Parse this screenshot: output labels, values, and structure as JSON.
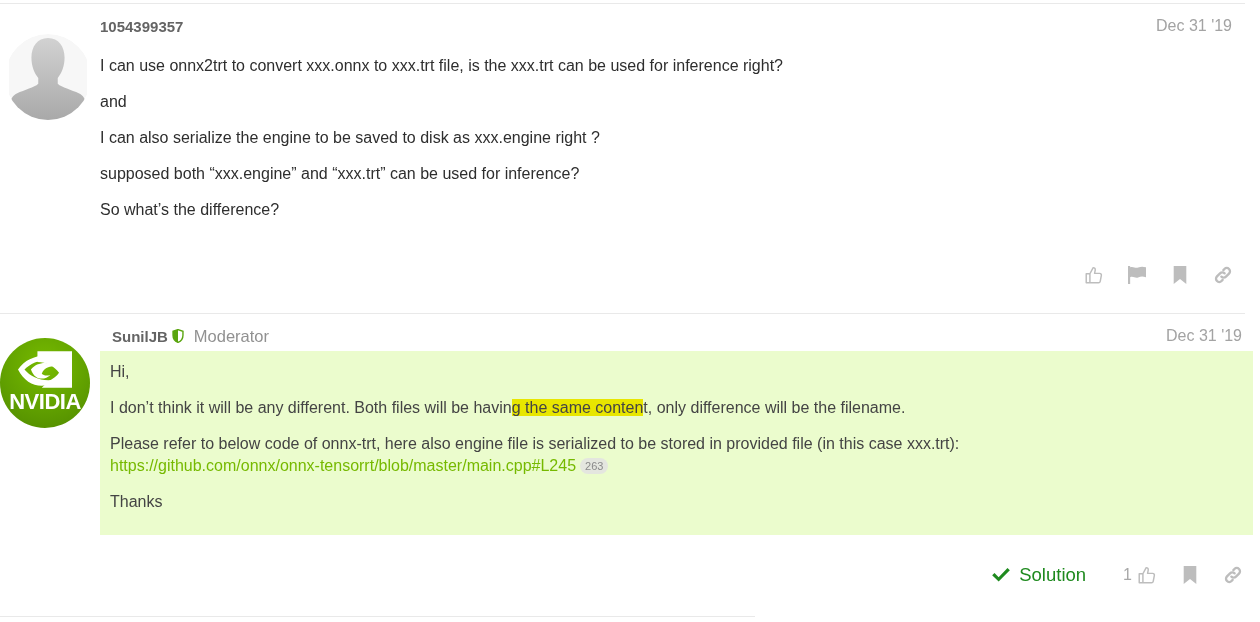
{
  "posts": [
    {
      "author": "1054399357",
      "avatar": {
        "kind": "silhouette"
      },
      "moderator": false,
      "date": "Dec 31 '19",
      "paragraphs": [
        {
          "kind": "text",
          "text": "I can use onnx2trt to convert xxx.onnx to xxx.trt file, is the xxx.trt can be used for inference right?"
        },
        {
          "kind": "text",
          "text": "and"
        },
        {
          "kind": "text",
          "text": "I can also serialize the engine to be saved to disk as xxx.engine right ?"
        },
        {
          "kind": "text",
          "text": "supposed both “xxx.engine” and “xxx.trt” can be used for inference?"
        },
        {
          "kind": "text",
          "text": "So what’s the difference?"
        }
      ],
      "actions": [
        {
          "kind": "like"
        },
        {
          "kind": "flag"
        },
        {
          "kind": "bookmark"
        },
        {
          "kind": "link"
        }
      ]
    },
    {
      "author": "SunilJB",
      "avatar": {
        "kind": "logo",
        "text": "NVIDIA"
      },
      "moderator": true,
      "role": "Moderator",
      "date": "Dec 31 '19",
      "paragraphs": [
        {
          "kind": "text",
          "text": "Hi,"
        },
        {
          "kind": "marked",
          "segments": [
            {
              "text": "I don’t think it will be any different. Both files will be havin",
              "highlighted": false
            },
            {
              "text": "g the same conten",
              "highlighted": true
            },
            {
              "text": "t, only difference will be the filename.",
              "highlighted": false
            }
          ]
        },
        {
          "kind": "link",
          "text": "Please refer to below code of onnx-trt, here also engine file is serialized to be stored in provided file (in this case xxx.trt):",
          "link": "https://github.com/onnx/onnx-tensorrt/blob/master/main.cpp#L245",
          "clicks": "263"
        },
        {
          "kind": "text",
          "text": "Thanks"
        }
      ],
      "actions": [
        {
          "kind": "solution",
          "label": "Solution"
        },
        {
          "kind": "like",
          "count": "1"
        },
        {
          "kind": "bookmark"
        },
        {
          "kind": "link"
        }
      ]
    }
  ]
}
